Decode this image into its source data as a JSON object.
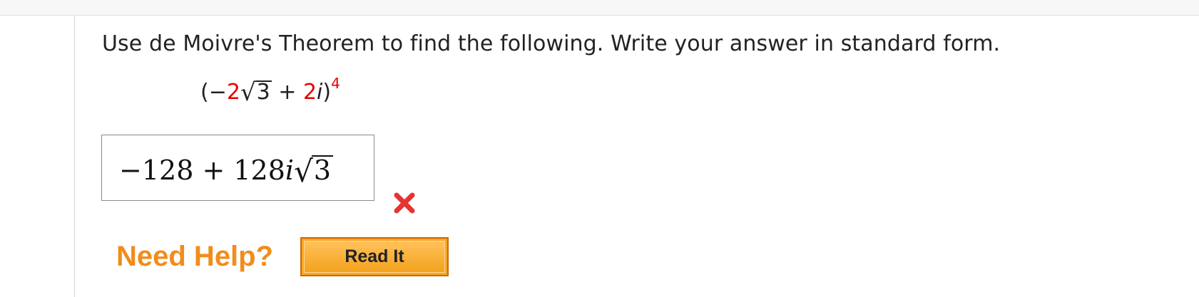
{
  "question": {
    "prompt": "Use de Moivre's Theorem to find the following. Write your answer in standard form.",
    "expression": {
      "open_paren": "(",
      "neg_sign": "−",
      "coef_real": "2",
      "radicand": "3",
      "plus": " + ",
      "coef_imag": "2",
      "imag_unit": "i",
      "close_paren": ")",
      "exponent": "4"
    }
  },
  "answer": {
    "prefix": "−128 + 128",
    "imag_unit": "i",
    "radicand": "3",
    "status": "incorrect",
    "status_color": "#e63333"
  },
  "help": {
    "label": "Need Help?",
    "read_it_label": "Read It"
  },
  "colors": {
    "highlight": "#e60000",
    "help_accent": "#f28c1a",
    "button_fill": "#f6a623"
  }
}
